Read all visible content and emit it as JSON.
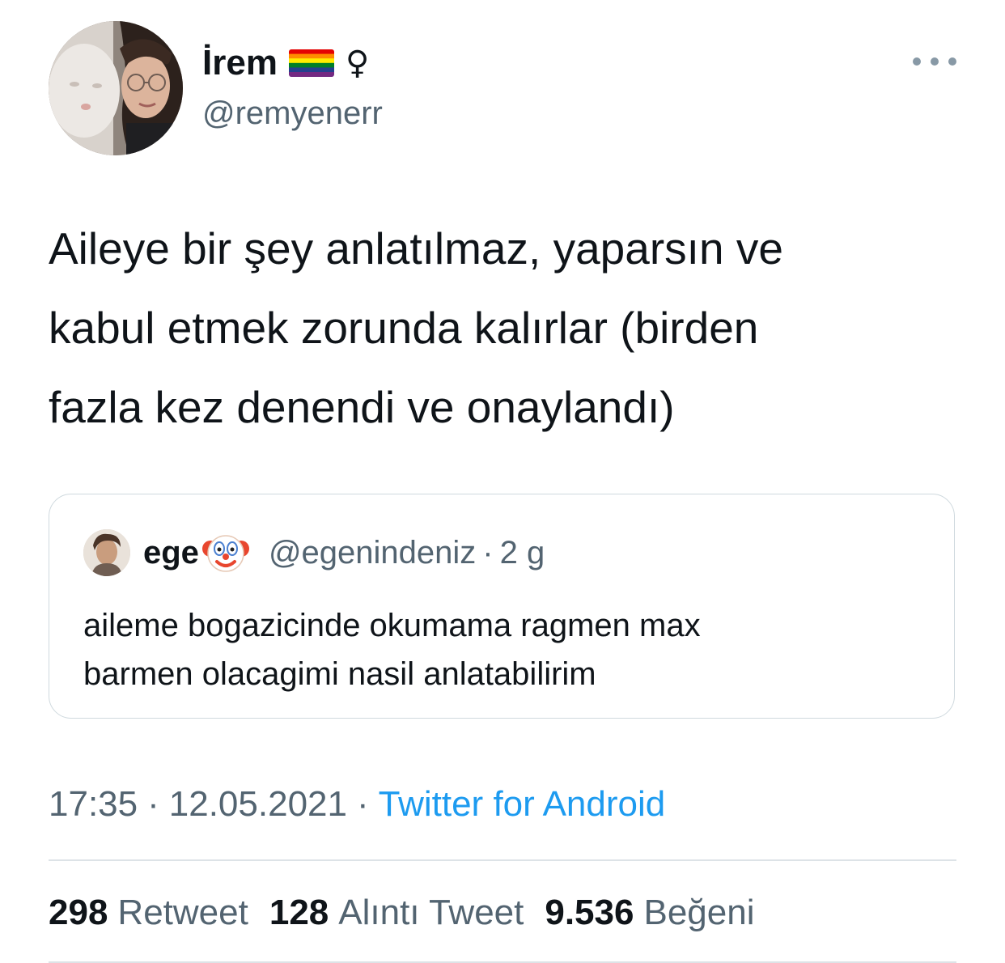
{
  "author": {
    "display_name": "İrem",
    "female_symbol": "♀",
    "handle": "@remyenerr",
    "flag_icon": "rainbow-flag-icon"
  },
  "tweet": {
    "text_lines": [
      "Aileye bir şey anlatılmaz, yaparsın ve",
      "kabul etmek zorunda kalırlar (birden",
      "fazla kez denendi ve onaylandı)"
    ],
    "time": "17:35",
    "date": "12.05.2021",
    "separator": "·",
    "source": "Twitter for Android"
  },
  "quoted_tweet": {
    "name": "ege",
    "name_emoji_icon": "clown-face-icon",
    "handle": "@egenindeniz",
    "separator": "·",
    "age": "2 g",
    "text_lines": [
      "aileme bogazicinde okumama ragmen max",
      "barmen olacagimi nasil anlatabilirim"
    ]
  },
  "stats": {
    "retweets_count": "298",
    "retweets_label": "Retweet",
    "quotes_count": "128",
    "quotes_label": "Alıntı Tweet",
    "likes_count": "9.536",
    "likes_label": "Beğeni"
  },
  "colors": {
    "text_primary": "#0f1419",
    "text_secondary": "#536471",
    "link": "#1d9bf0",
    "border": "#cfd9de",
    "divider": "#dde3e7"
  }
}
